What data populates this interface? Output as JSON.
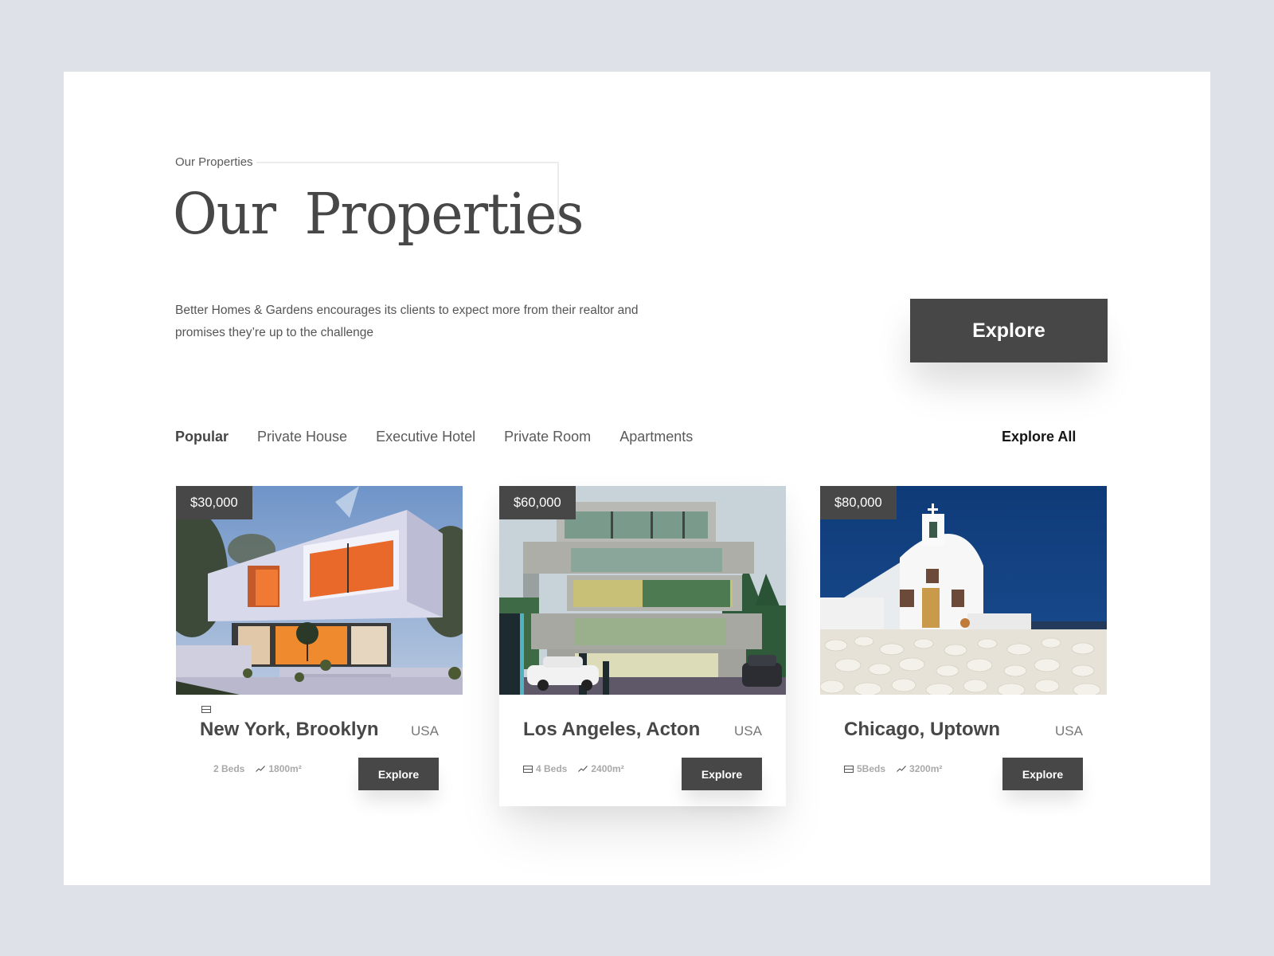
{
  "header": {
    "eyebrow": "Our Properties",
    "title": "Our Properties",
    "description": "Better Homes & Gardens encourages its clients to expect more from their realtor and promises they’re up to the challenge",
    "cta_label": "Explore"
  },
  "tabs": [
    {
      "label": "Popular",
      "active": true
    },
    {
      "label": "Private House",
      "active": false
    },
    {
      "label": "Executive Hotel",
      "active": false
    },
    {
      "label": "Private Room",
      "active": false
    },
    {
      "label": "Apartments",
      "active": false
    }
  ],
  "explore_all_label": "Explore All",
  "cards": [
    {
      "price": "$30,000",
      "name": "New York, Brooklyn",
      "country": "USA",
      "beds": "2 Beds",
      "area": "1800m²",
      "button_label": "Explore",
      "image": "modern-white-villa-at-dusk",
      "icons": [
        "bed-icon",
        "trend-icon"
      ]
    },
    {
      "price": "$60,000",
      "name": "Los Angeles, Acton",
      "country": "USA",
      "beds": "4 Beds",
      "area": "2400m²",
      "button_label": "Explore",
      "image": "modern-apartment-building-with-ev-chargers",
      "icons": [
        "bed-icon",
        "trend-icon"
      ]
    },
    {
      "price": "$80,000",
      "name": "Chicago, Uptown",
      "country": "USA",
      "beds": "5Beds",
      "area": "3200m²",
      "button_label": "Explore",
      "image": "white-chapel-with-blue-sky",
      "icons": [
        "bed-icon",
        "trend-icon"
      ]
    }
  ],
  "colors": {
    "page_background": "#dee1e8",
    "panel": "#ffffff",
    "dark_button": "#474747",
    "title_text": "#474747",
    "muted_text": "#a9a9a9"
  }
}
